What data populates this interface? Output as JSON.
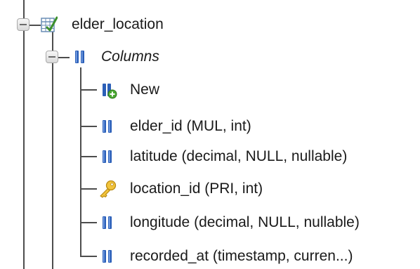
{
  "tree": {
    "table": {
      "label": "elder_location",
      "icon": "table-icon"
    },
    "columns_group": {
      "label": "Columns",
      "icon": "columns-icon"
    },
    "items": [
      {
        "label": "New",
        "icon": "new-column-icon"
      },
      {
        "label": "elder_id (MUL, int)",
        "icon": "column-icon"
      },
      {
        "label": "latitude (decimal, NULL, nullable)",
        "icon": "column-icon"
      },
      {
        "label": "location_id (PRI, int)",
        "icon": "primary-key-icon"
      },
      {
        "label": "longitude (decimal, NULL, nullable)",
        "icon": "column-icon"
      },
      {
        "label": "recorded_at (timestamp, curren...)",
        "icon": "column-icon"
      }
    ]
  }
}
